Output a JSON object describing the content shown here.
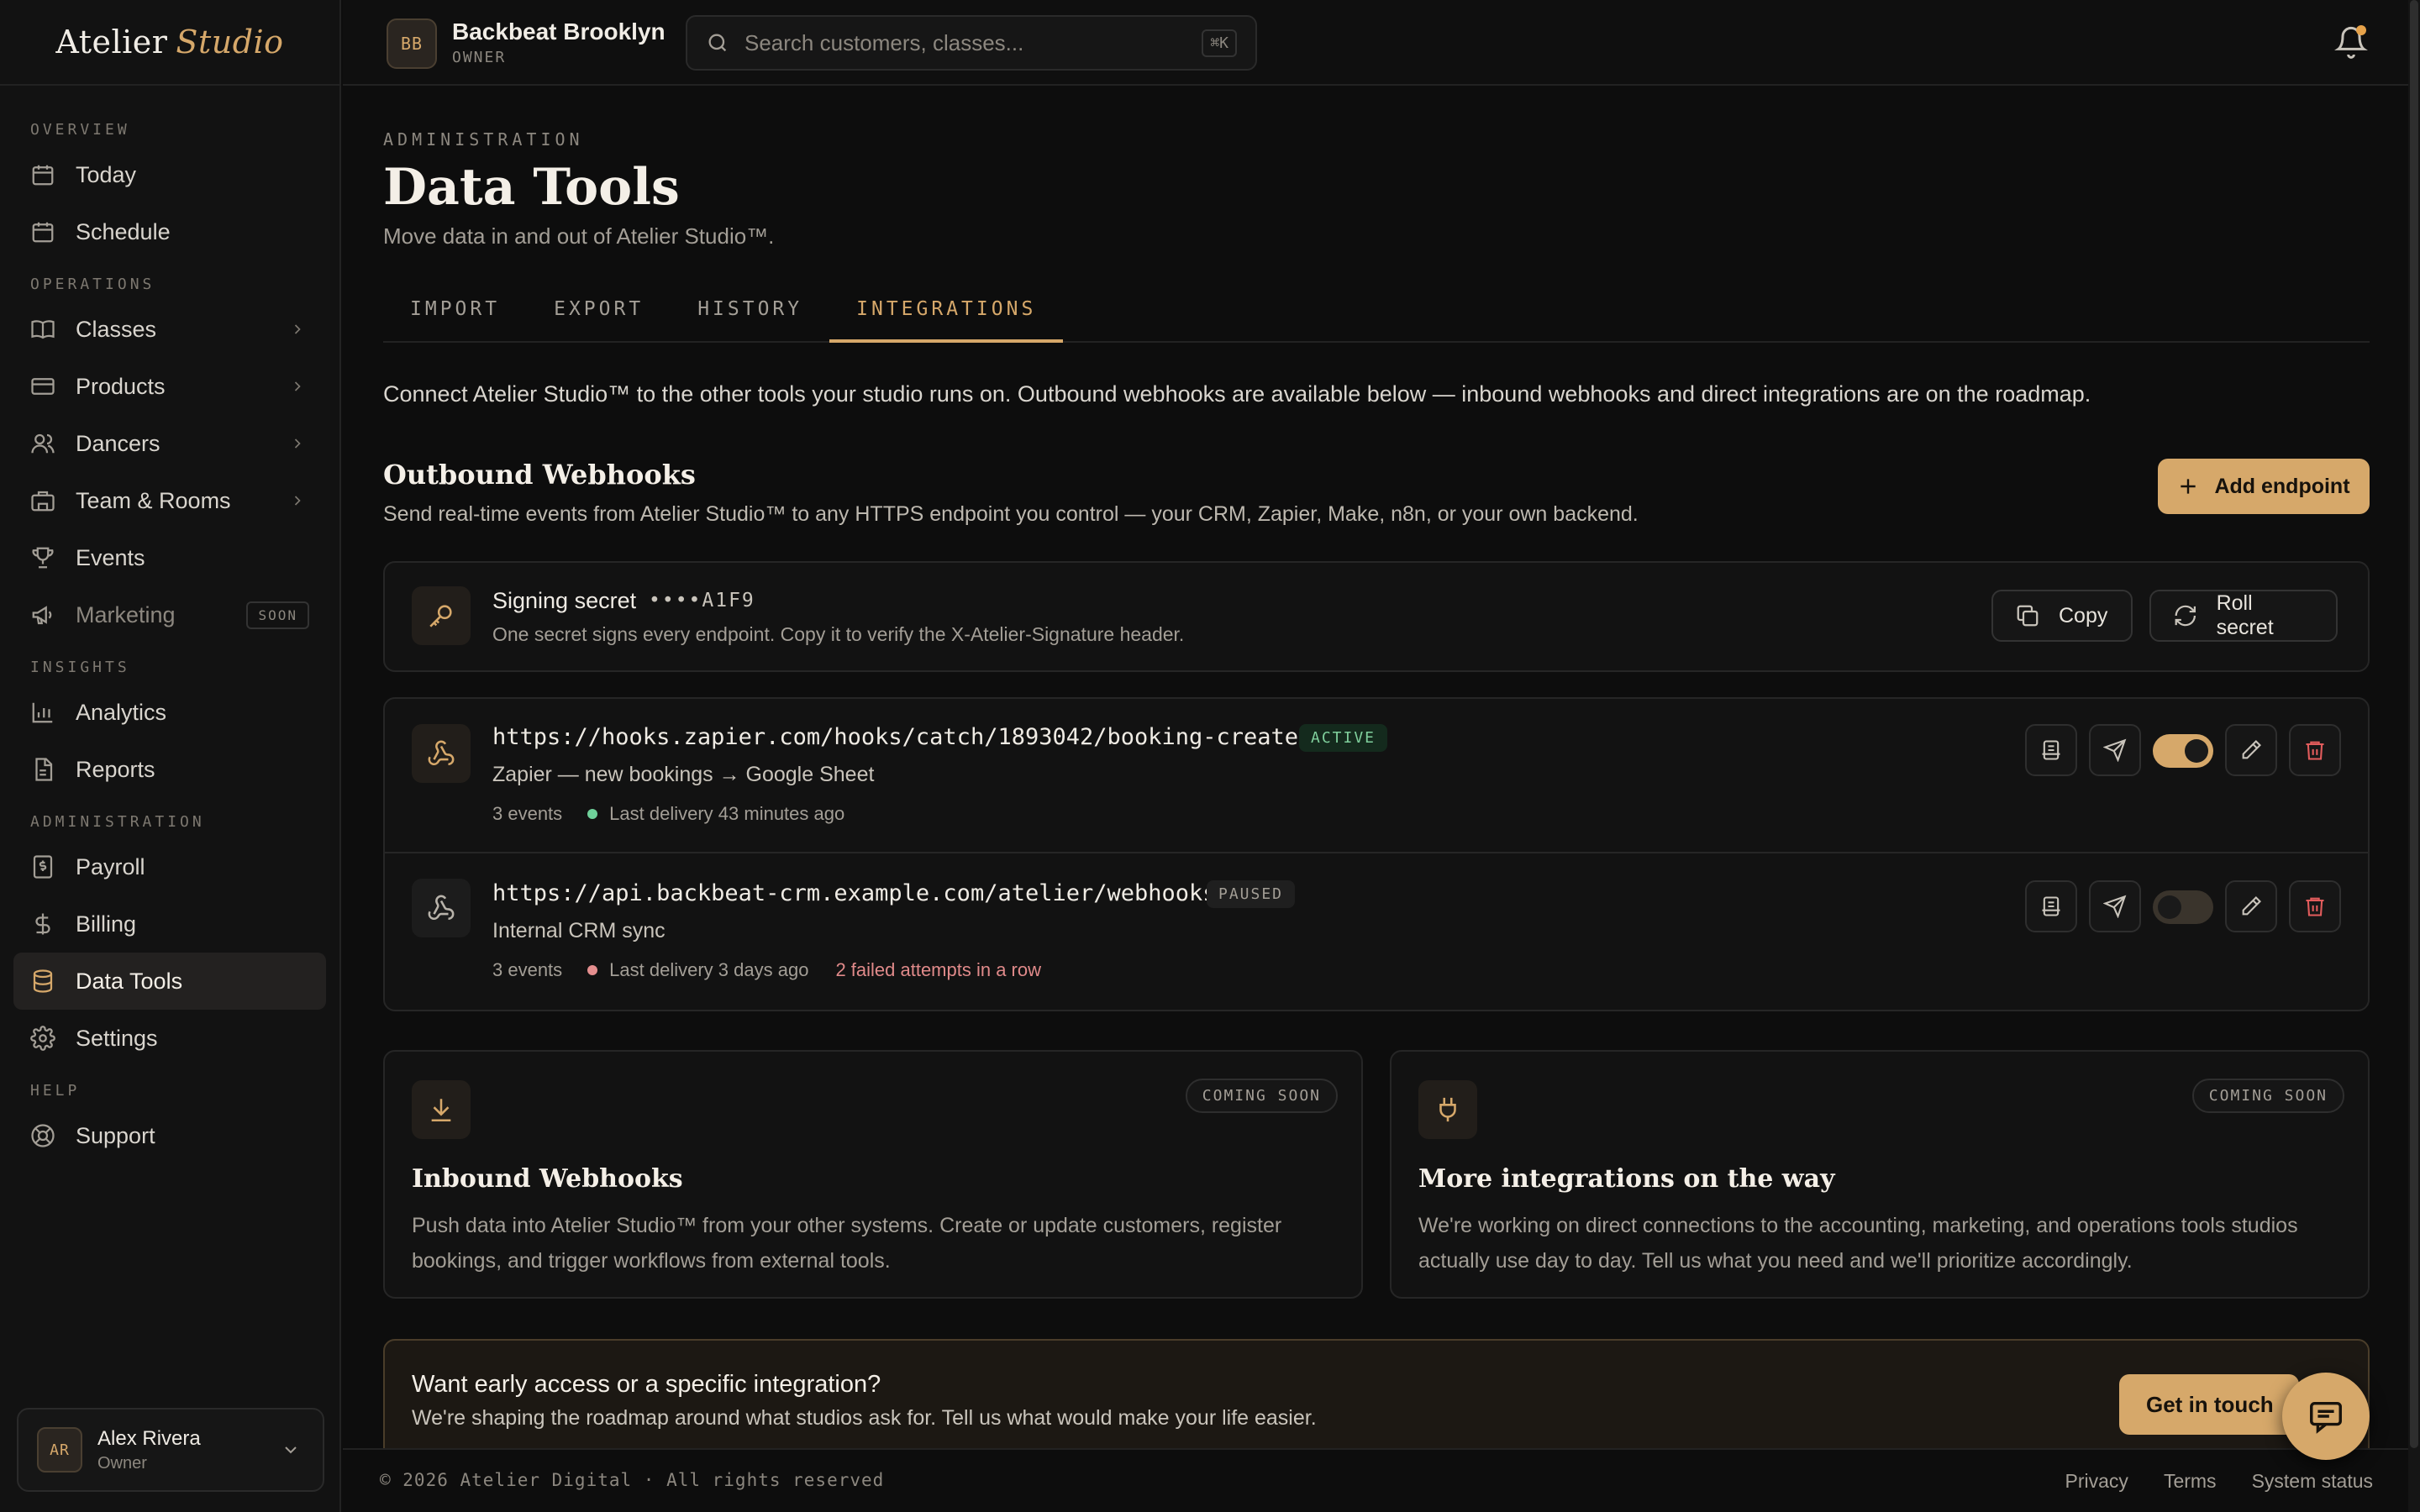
{
  "brand": {
    "name": "Atelier",
    "accent": "Studio"
  },
  "sidebar": {
    "sections": [
      {
        "label": "OVERVIEW",
        "items": [
          {
            "label": "Today",
            "icon": "calendar-icon"
          },
          {
            "label": "Schedule",
            "icon": "calendar-grid-icon"
          }
        ]
      },
      {
        "label": "OPERATIONS",
        "items": [
          {
            "label": "Classes",
            "icon": "book-icon"
          },
          {
            "label": "Products",
            "icon": "card-icon"
          },
          {
            "label": "Dancers",
            "icon": "users-icon"
          },
          {
            "label": "Team & Rooms",
            "icon": "building-icon"
          },
          {
            "label": "Events",
            "icon": "trophy-icon"
          },
          {
            "label": "Marketing",
            "icon": "megaphone-icon",
            "badge": "SOON"
          }
        ]
      },
      {
        "label": "INSIGHTS",
        "items": [
          {
            "label": "Analytics",
            "icon": "bar-chart-icon"
          },
          {
            "label": "Reports",
            "icon": "document-icon"
          }
        ]
      },
      {
        "label": "ADMINISTRATION",
        "items": [
          {
            "label": "Payroll",
            "icon": "receipt-icon"
          },
          {
            "label": "Billing",
            "icon": "dollar-icon"
          },
          {
            "label": "Data Tools",
            "icon": "database-icon"
          },
          {
            "label": "Settings",
            "icon": "gear-icon"
          }
        ]
      },
      {
        "label": "HELP",
        "items": [
          {
            "label": "Support",
            "icon": "lifebuoy-icon"
          }
        ]
      }
    ],
    "user": {
      "initials": "AR",
      "name": "Alex Rivera",
      "role": "Owner"
    }
  },
  "topbar": {
    "studio_initials": "BB",
    "studio_name": "Backbeat Brooklyn",
    "studio_role": "OWNER",
    "search_placeholder": "Search customers, classes...",
    "search_shortcut": "⌘K"
  },
  "page": {
    "eyebrow": "ADMINISTRATION",
    "title": "Data Tools",
    "subtitle": "Move data in and out of Atelier Studio™.",
    "tabs": [
      "IMPORT",
      "EXPORT",
      "HISTORY",
      "INTEGRATIONS"
    ],
    "active_tab": "INTEGRATIONS",
    "intro": "Connect Atelier Studio™ to the other tools your studio runs on. Outbound webhooks are available below — inbound webhooks and direct integrations are on the roadmap."
  },
  "webhooks": {
    "title": "Outbound Webhooks",
    "subtitle": "Send real-time events from Atelier Studio™ to any HTTPS endpoint you control — your CRM, Zapier, Make, n8n, or your own backend.",
    "add_label": "Add endpoint",
    "secret": {
      "label": "Signing secret",
      "masked": "••••A1F9",
      "help": "One secret signs every endpoint. Copy it to verify the X-Atelier-Signature header.",
      "copy_label": "Copy",
      "roll_label": "Roll secret"
    },
    "endpoints": [
      {
        "url": "https://hooks.zapier.com/hooks/catch/1893042/booking-created",
        "status": "ACTIVE",
        "name": "Zapier — new bookings → Google Sheet",
        "events": "3 events",
        "delivery": "Last delivery 43 minutes ago",
        "failures": "",
        "enabled": true,
        "dot_color": "#6fd19a"
      },
      {
        "url": "https://api.backbeat-crm.example.com/atelier/webhooks",
        "status": "PAUSED",
        "name": "Internal CRM sync",
        "events": "3 events",
        "delivery": "Last delivery 3 days ago",
        "failures": "2 failed attempts in a row",
        "enabled": false,
        "dot_color": "#e58f8f"
      }
    ]
  },
  "coming": [
    {
      "badge": "COMING SOON",
      "title": "Inbound Webhooks",
      "body": "Push data into Atelier Studio™ from your other systems. Create or update customers, register bookings, and trigger workflows from external tools.",
      "icon": "download-icon"
    },
    {
      "badge": "COMING SOON",
      "title": "More integrations on the way",
      "body": "We're working on direct connections to the accounting, marketing, and operations tools studios actually use day to day. Tell us what you need and we'll prioritize accordingly.",
      "icon": "plug-icon"
    }
  ],
  "cta": {
    "title": "Want early access or a specific integration?",
    "body": "We're shaping the roadmap around what studios ask for. Tell us what would make your life easier.",
    "button": "Get in touch"
  },
  "footer": {
    "copyright": "© 2026 Atelier Digital · All rights reserved",
    "links": [
      "Privacy",
      "Terms",
      "System status"
    ]
  },
  "colors": {
    "accent": "#d6a86a",
    "background": "#0d0d0d",
    "success": "#6fd19a",
    "danger": "#e25c5c"
  }
}
